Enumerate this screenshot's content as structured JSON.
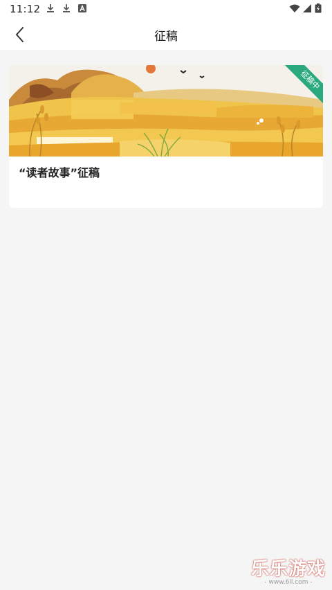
{
  "status_bar": {
    "time": "11:12",
    "icons": [
      "download-icon",
      "download-icon",
      "a-icon",
      "wifi-icon",
      "signal-icon",
      "battery-icon"
    ]
  },
  "header": {
    "title": "征稿",
    "back_icon": "chevron-left-icon"
  },
  "cards": [
    {
      "title": "“读者故事”征稿",
      "badge": "征稿中",
      "badge_color": "#2aa97e"
    }
  ],
  "watermark": {
    "brand": "乐乐游戏",
    "site": "- www.6ll.com -"
  },
  "colors": {
    "background": "#f5f5f5",
    "card": "#ffffff",
    "accent": "#2aa97e",
    "harvest_gold": "#e8b43a"
  }
}
